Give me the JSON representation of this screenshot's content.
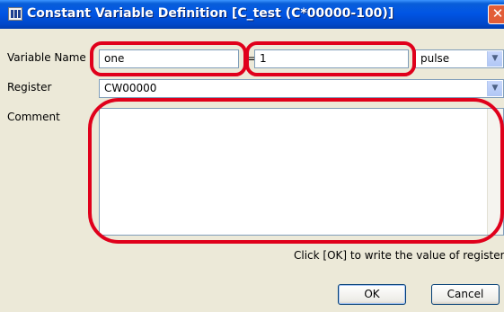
{
  "window": {
    "title": "Constant Variable Definition [C_test (C*00000-100)]",
    "close_glyph": "✕"
  },
  "form": {
    "variable_name_label": "Variable Name",
    "variable_name_value": "one",
    "equals": "=",
    "value": "1",
    "unit_value": "pulse",
    "register_label": "Register",
    "register_value": "CW00000",
    "comment_label": "Comment",
    "comment_value": ""
  },
  "hint": "Click [OK] to write the value of register C.",
  "buttons": {
    "ok": "OK",
    "cancel": "Cancel"
  },
  "icons": {
    "app": "table-icon",
    "close": "close-icon",
    "dropdown": "chevron-down-icon"
  },
  "colors": {
    "titlebar": "#0055e5",
    "highlight": "#e0001b",
    "dialog_bg": "#ece9d8"
  }
}
